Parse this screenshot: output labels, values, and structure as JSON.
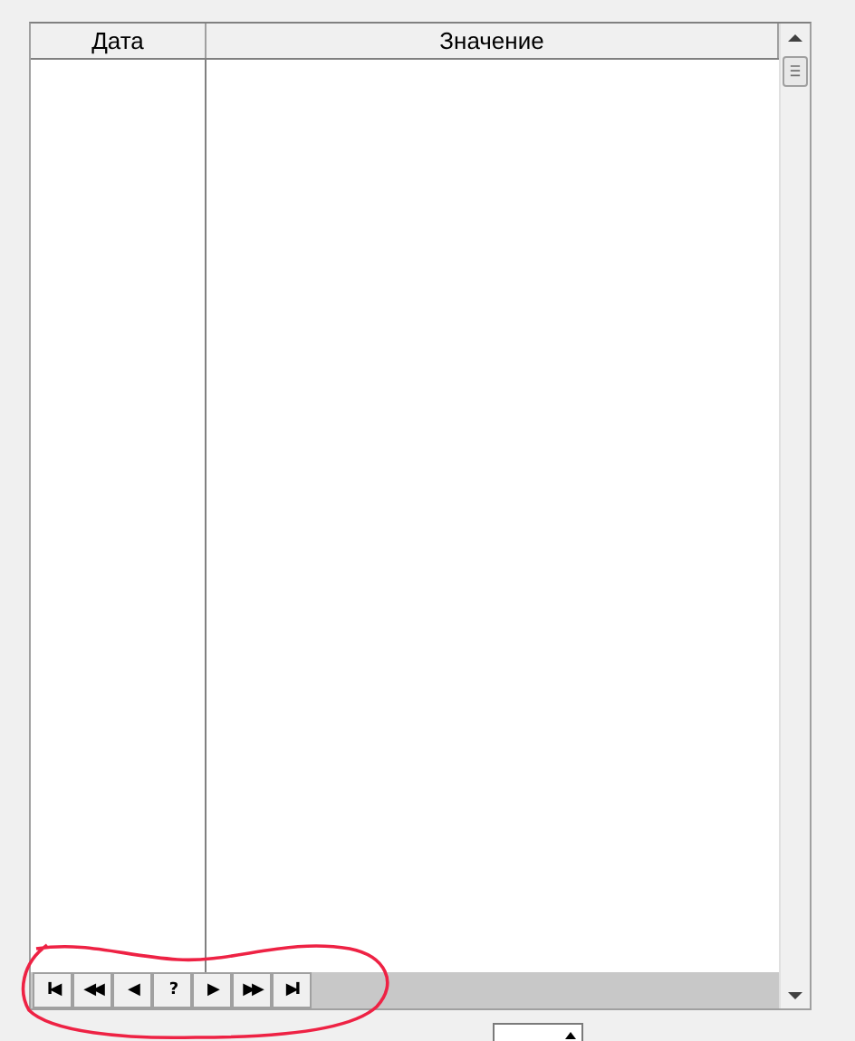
{
  "table": {
    "columns": [
      "Дата",
      "Значение"
    ]
  },
  "navigator": {
    "buttons": [
      "I◀",
      "◀◀",
      "◀",
      "?",
      "▶",
      "▶▶",
      "▶I"
    ]
  }
}
